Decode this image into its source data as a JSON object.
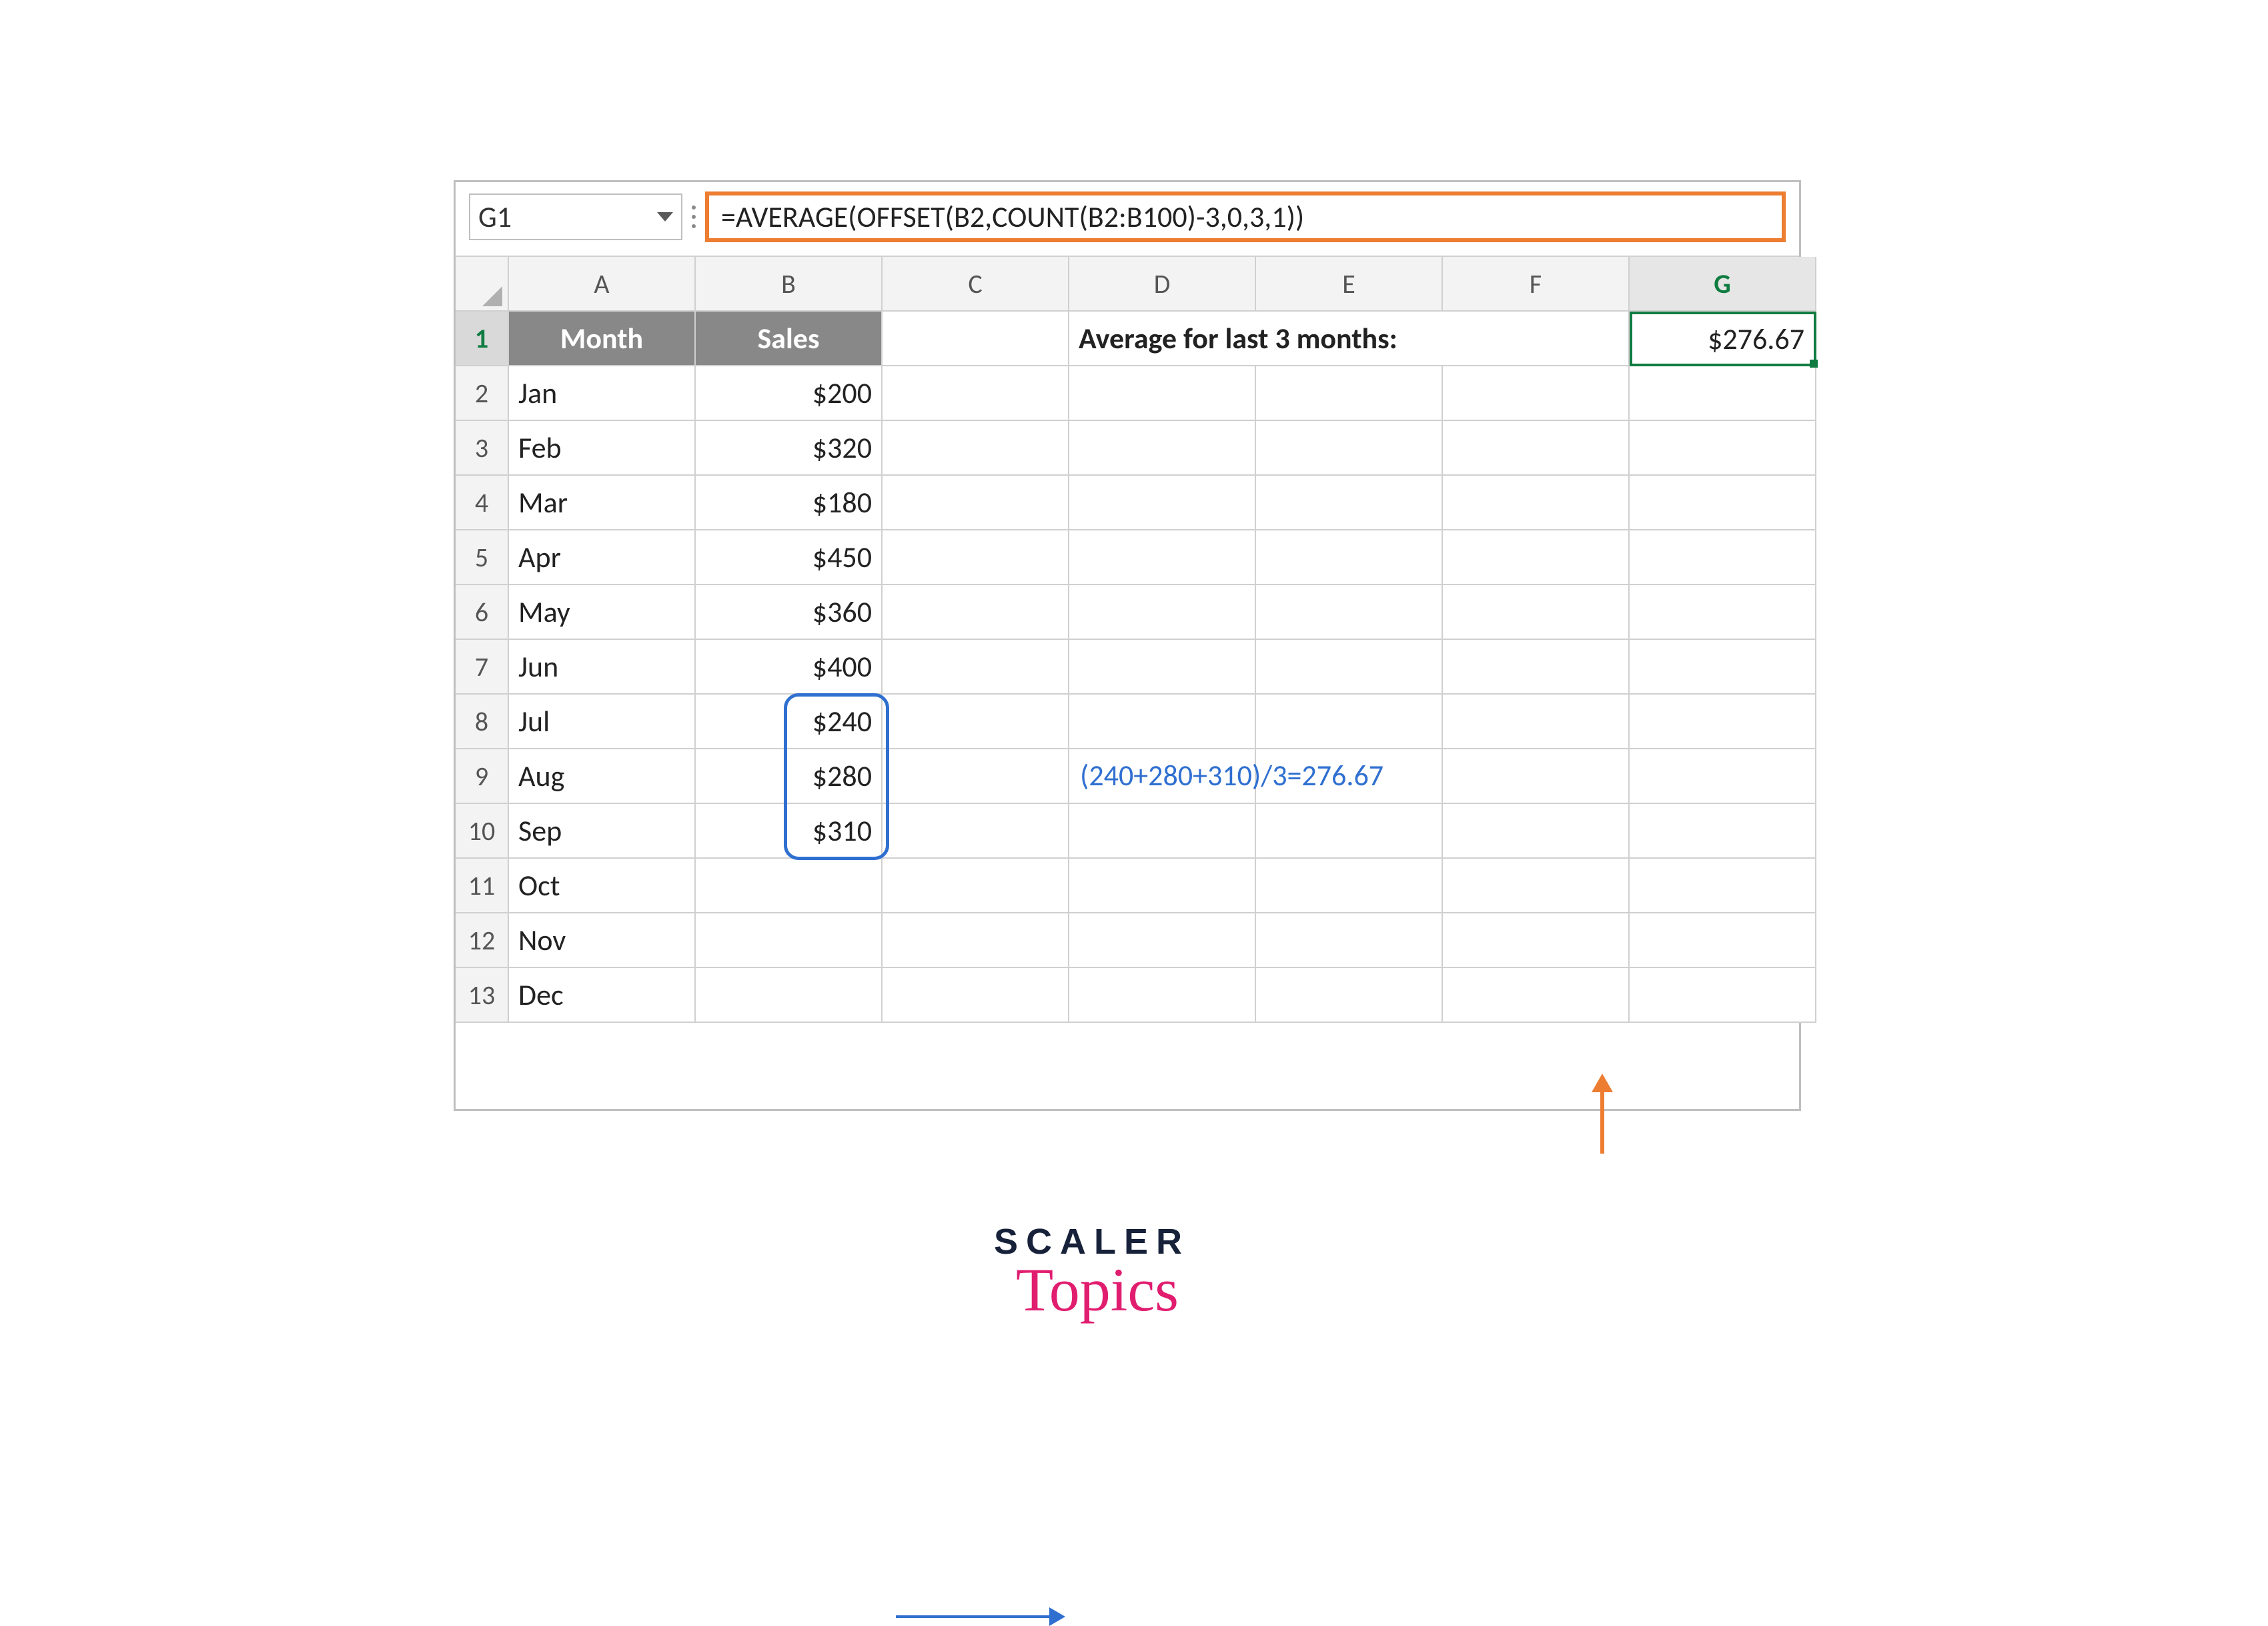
{
  "namebox": "G1",
  "formula": "=AVERAGE(OFFSET(B2,COUNT(B2:B100)-3,0,3,1))",
  "columns": [
    "A",
    "B",
    "C",
    "D",
    "E",
    "F",
    "G"
  ],
  "active_column": "G",
  "active_row": "1",
  "header": {
    "A": "Month",
    "B": "Sales"
  },
  "avg_label": "Average for last 3 months:",
  "avg_value": "$276.67",
  "rows": [
    {
      "r": "2",
      "month": "Jan",
      "sales": "$200"
    },
    {
      "r": "3",
      "month": "Feb",
      "sales": "$320"
    },
    {
      "r": "4",
      "month": "Mar",
      "sales": "$180"
    },
    {
      "r": "5",
      "month": "Apr",
      "sales": "$450"
    },
    {
      "r": "6",
      "month": "May",
      "sales": "$360"
    },
    {
      "r": "7",
      "month": "Jun",
      "sales": "$400"
    },
    {
      "r": "8",
      "month": "Jul",
      "sales": "$240"
    },
    {
      "r": "9",
      "month": "Aug",
      "sales": "$280"
    },
    {
      "r": "10",
      "month": "Sep",
      "sales": "$310"
    },
    {
      "r": "11",
      "month": "Oct",
      "sales": ""
    },
    {
      "r": "12",
      "month": "Nov",
      "sales": ""
    },
    {
      "r": "13",
      "month": "Dec",
      "sales": ""
    }
  ],
  "annotation_calc": "(240+280+310)/3=276.67",
  "logo": {
    "line1": "SCALER",
    "line2": "Topics"
  }
}
